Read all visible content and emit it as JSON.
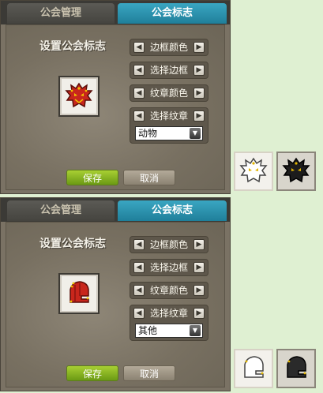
{
  "panels": [
    {
      "tab_guild_manage": "公会管理",
      "tab_guild_emblem": "公会标志",
      "title": "设置公会标志",
      "border_color": "边框颜色",
      "select_border": "选择边框",
      "pattern_color": "纹章颜色",
      "select_pattern": "选择纹章",
      "pattern_category": "动物",
      "save": "保存",
      "cancel": "取消",
      "emblem_icon": "dragon-head-icon"
    },
    {
      "tab_guild_manage": "公会管理",
      "tab_guild_emblem": "公会标志",
      "title": "设置公会标志",
      "border_color": "边框颜色",
      "select_border": "选择边框",
      "pattern_color": "纹章颜色",
      "select_pattern": "选择纹章",
      "pattern_category": "其他",
      "save": "保存",
      "cancel": "取消",
      "emblem_icon": "knight-helmet-icon"
    }
  ],
  "previews": [
    {
      "icon": "dragon-head-white-icon"
    },
    {
      "icon": "dragon-head-black-icon"
    },
    {
      "icon": "knight-helmet-white-icon"
    },
    {
      "icon": "knight-helmet-black-icon"
    }
  ],
  "colors": {
    "active_tab": "#2a93b0",
    "save_button": "#8fbc22",
    "emblem_red": "#c8261c",
    "emblem_gold": "#e0b400"
  }
}
